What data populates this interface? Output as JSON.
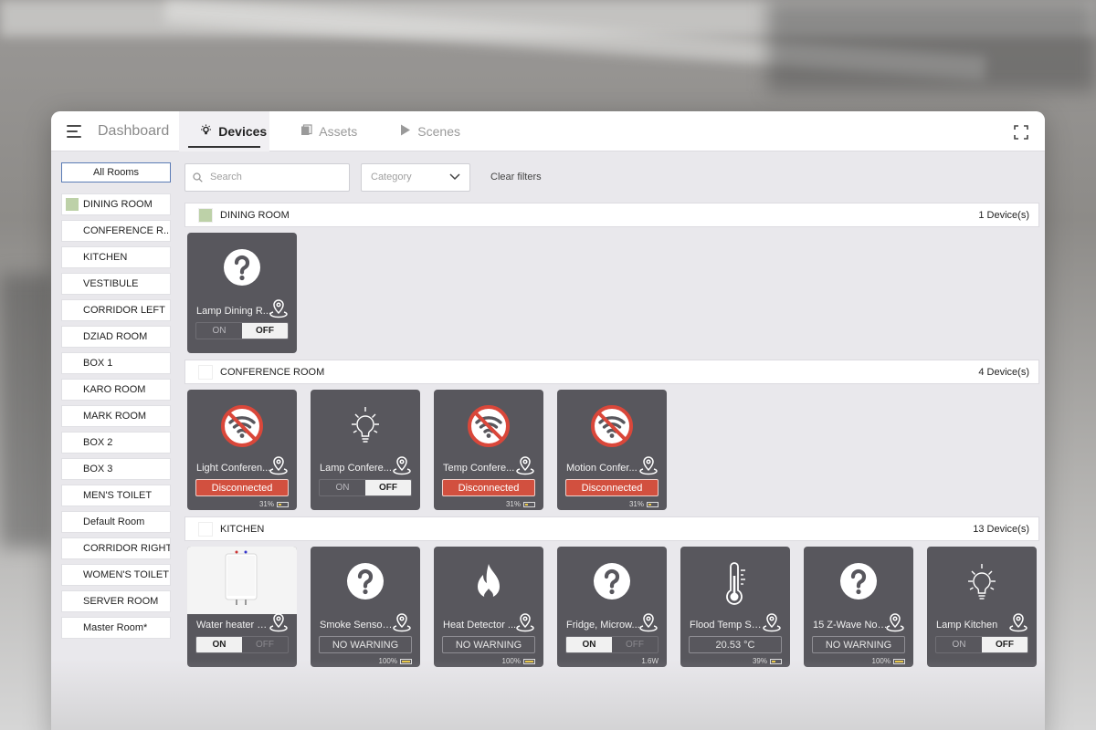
{
  "header": {
    "dashboard": "Dashboard",
    "tabs": [
      {
        "label": "Devices",
        "icon": "bulb-icon"
      },
      {
        "label": "Assets",
        "icon": "assets-icon"
      },
      {
        "label": "Scenes",
        "icon": "play-icon"
      }
    ]
  },
  "filters": {
    "search_placeholder": "Search",
    "category_placeholder": "Category",
    "clear": "Clear filters"
  },
  "sidebar": {
    "all_rooms": "All Rooms",
    "rooms": [
      {
        "label": "DINING ROOM",
        "color": "#bdd1a8"
      },
      {
        "label": "CONFERENCE R...",
        "color": "#ffffff"
      },
      {
        "label": "KITCHEN",
        "color": "#ffffff"
      },
      {
        "label": "VESTIBULE",
        "color": "#ffffff"
      },
      {
        "label": "CORRIDOR LEFT",
        "color": "#ffffff"
      },
      {
        "label": "DZIAD ROOM",
        "color": "#ffffff"
      },
      {
        "label": "BOX 1",
        "color": "#ffffff"
      },
      {
        "label": "KARO ROOM",
        "color": "#ffffff"
      },
      {
        "label": "MARK ROOM",
        "color": "#ffffff"
      },
      {
        "label": "BOX 2",
        "color": "#ffffff"
      },
      {
        "label": "BOX 3",
        "color": "#ffffff"
      },
      {
        "label": "MEN'S TOILET",
        "color": "#ffffff"
      },
      {
        "label": "Default Room",
        "color": "#ffffff"
      },
      {
        "label": "CORRIDOR RIGHT",
        "color": "#ffffff"
      },
      {
        "label": "WOMEN'S TOILET",
        "color": "#ffffff"
      },
      {
        "label": "SERVER ROOM",
        "color": "#ffffff"
      },
      {
        "label": "Master Room*",
        "color": "#ffffff"
      }
    ]
  },
  "sections": [
    {
      "name": "DINING ROOM",
      "count": "1 Device(s)",
      "color": "#bdd1a8",
      "devices": [
        {
          "label": "Lamp Dining R...",
          "icon": "question-icon",
          "on_label": "ON",
          "off_label": "OFF"
        }
      ]
    },
    {
      "name": "CONFERENCE ROOM",
      "count": "4 Device(s)",
      "color": "#ffffff",
      "devices": [
        {
          "label": "Light Conferen...",
          "icon": "no-wifi-icon",
          "status": "Disconnected",
          "battery": "31%"
        },
        {
          "label": "Lamp Confere...",
          "icon": "bulb-icon",
          "on_label": "ON",
          "off_label": "OFF"
        },
        {
          "label": "Temp Confere...",
          "icon": "no-wifi-icon",
          "status": "Disconnected",
          "battery": "31%"
        },
        {
          "label": "Motion Confer...",
          "icon": "no-wifi-icon",
          "status": "Disconnected",
          "battery": "31%"
        }
      ]
    },
    {
      "name": "KITCHEN",
      "count": "13 Device(s)",
      "color": "#ffffff",
      "devices": [
        {
          "label": "Water heater K...",
          "icon": "water-heater-photo",
          "on_label": "ON",
          "off_label": "OFF"
        },
        {
          "label": "Smoke Sensor ...",
          "icon": "question-icon",
          "status": "NO WARNING",
          "battery": "100%"
        },
        {
          "label": "Heat Detector ...",
          "icon": "flame-icon",
          "status": "NO WARNING",
          "battery": "100%"
        },
        {
          "label": "Fridge, Microw...",
          "icon": "question-icon",
          "on_label": "ON",
          "off_label": "OFF",
          "power": "1.6W"
        },
        {
          "label": "Flood Temp Se...",
          "icon": "thermometer-icon",
          "status": "20.53 °C",
          "battery": "39%"
        },
        {
          "label": "15 Z-Wave Node",
          "icon": "question-icon",
          "status": "NO WARNING",
          "battery": "100%"
        },
        {
          "label": "Lamp Kitchen",
          "icon": "bulb-icon",
          "on_label": "ON",
          "off_label": "OFF"
        }
      ]
    }
  ]
}
